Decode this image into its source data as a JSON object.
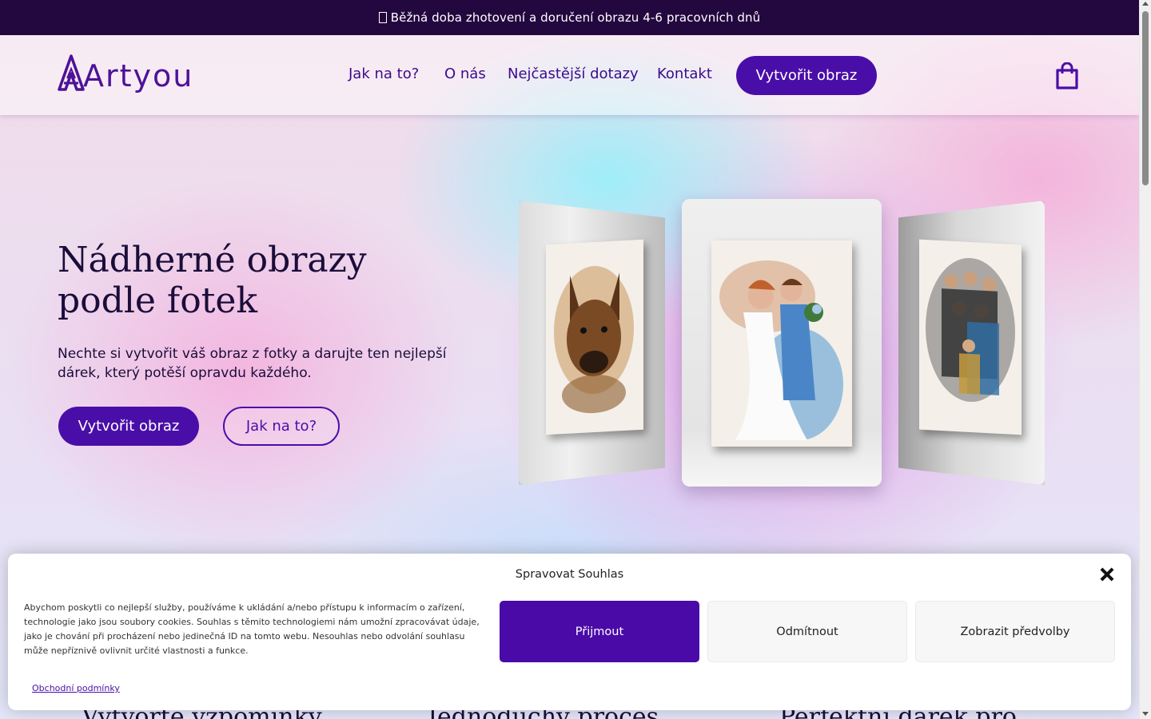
{
  "announcement": {
    "icon": "unknown-glyph-icon",
    "text": "Běžná doba zhotovení a doručení obrazu 4-6 pracovních dnů"
  },
  "header": {
    "logo_text": "Artyou",
    "nav": [
      {
        "label": "Jak na to?"
      },
      {
        "label": "O nás"
      },
      {
        "label": "Nejčastější dotazy"
      },
      {
        "label": "Kontakt"
      }
    ],
    "cta_label": "Vytvořit obraz",
    "cart_icon": "shopping-bag-icon"
  },
  "hero": {
    "title_line1": "Nádherné obrazy",
    "title_line2": "podle fotek",
    "subtitle": "Nechte si vytvořit váš obraz z fotky a darujte ten nejlepší dárek, který potěší opravdu každého.",
    "primary_button": "Vytvořit obraz",
    "secondary_button": "Jak na to?",
    "cards": [
      "dog-portrait-canvas",
      "wedding-couple-canvas",
      "family-portrait-canvas"
    ]
  },
  "below_headings": [
    "Vytvořte vzpomínky",
    "Jednoduchý proces",
    "Perfektní dárek pro"
  ],
  "consent": {
    "title": "Spravovat Souhlas",
    "text": "Abychom poskytli co nejlepší služby, používáme k ukládání a/nebo přístupu k informacím o zařízení, technologie jako jsou soubory cookies. Souhlas s těmito technologiemi nám umožní zpracovávat údaje, jako je chování při procházení nebo jedinečná ID na tomto webu. Nesouhlas nebo odvolání souhlasu může nepříznivě ovlivnit určité vlastnosti a funkce.",
    "link": "Obchodní podmínky",
    "accept": "Přijmout",
    "deny": "Odmítnout",
    "preferences": "Zobrazit předvolby"
  },
  "colors": {
    "brand": "#4a0ea8",
    "announce_bg": "#23083f",
    "heading": "#1a0d3a"
  }
}
